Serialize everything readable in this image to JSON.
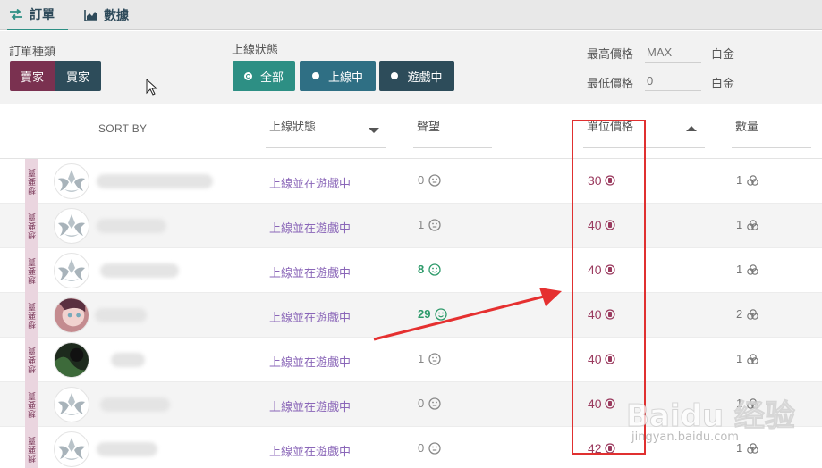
{
  "tabs": [
    {
      "label": "訂單",
      "icon": "swap-arrows-icon",
      "active": true
    },
    {
      "label": "數據",
      "icon": "area-chart-icon",
      "active": false
    }
  ],
  "filters": {
    "order_type": {
      "label": "訂單種類",
      "options": [
        "賣家",
        "買家"
      ]
    },
    "online_status": {
      "label": "上線狀態",
      "options": [
        "全部",
        "上線中",
        "遊戲中"
      ],
      "selected": "全部"
    },
    "max_price": {
      "label": "最高價格",
      "placeholder": "MAX",
      "unit": "白金"
    },
    "min_price": {
      "label": "最低價格",
      "placeholder": "0",
      "unit": "白金"
    }
  },
  "header": {
    "sort_by": "SORT BY",
    "status": "上線狀態",
    "reputation": "聲望",
    "unit_price": "單位價格",
    "quantity": "數量"
  },
  "wts_label": "想要賣",
  "rows": [
    {
      "status": "上線並在遊戲中",
      "reputation": "0",
      "rep_positive": false,
      "price": "30",
      "qty": "1",
      "avatar": "warframe-logo"
    },
    {
      "status": "上線並在遊戲中",
      "reputation": "1",
      "rep_positive": false,
      "price": "40",
      "qty": "1",
      "avatar": "warframe-logo"
    },
    {
      "status": "上線並在遊戲中",
      "reputation": "8",
      "rep_positive": true,
      "price": "40",
      "qty": "1",
      "avatar": "warframe-logo"
    },
    {
      "status": "上線並在遊戲中",
      "reputation": "29",
      "rep_positive": true,
      "price": "40",
      "qty": "2",
      "avatar": "anime-portrait"
    },
    {
      "status": "上線並在遊戲中",
      "reputation": "1",
      "rep_positive": false,
      "price": "40",
      "qty": "1",
      "avatar": "dark-portrait"
    },
    {
      "status": "上線並在遊戲中",
      "reputation": "0",
      "rep_positive": false,
      "price": "40",
      "qty": "1",
      "avatar": "warframe-logo"
    },
    {
      "status": "上線並在遊戲中",
      "reputation": "0",
      "rep_positive": false,
      "price": "42",
      "qty": "1",
      "avatar": "warframe-logo"
    }
  ],
  "watermark": {
    "main": "Baidu 经验",
    "sub": "jingyan.baidu.com"
  },
  "colors": {
    "seller": "#7a3150",
    "buyer": "#2d4c5a",
    "teal": "#2d8f84",
    "price": "#9a3a5e",
    "status": "#8a66b8",
    "annotation": "#e03030"
  }
}
